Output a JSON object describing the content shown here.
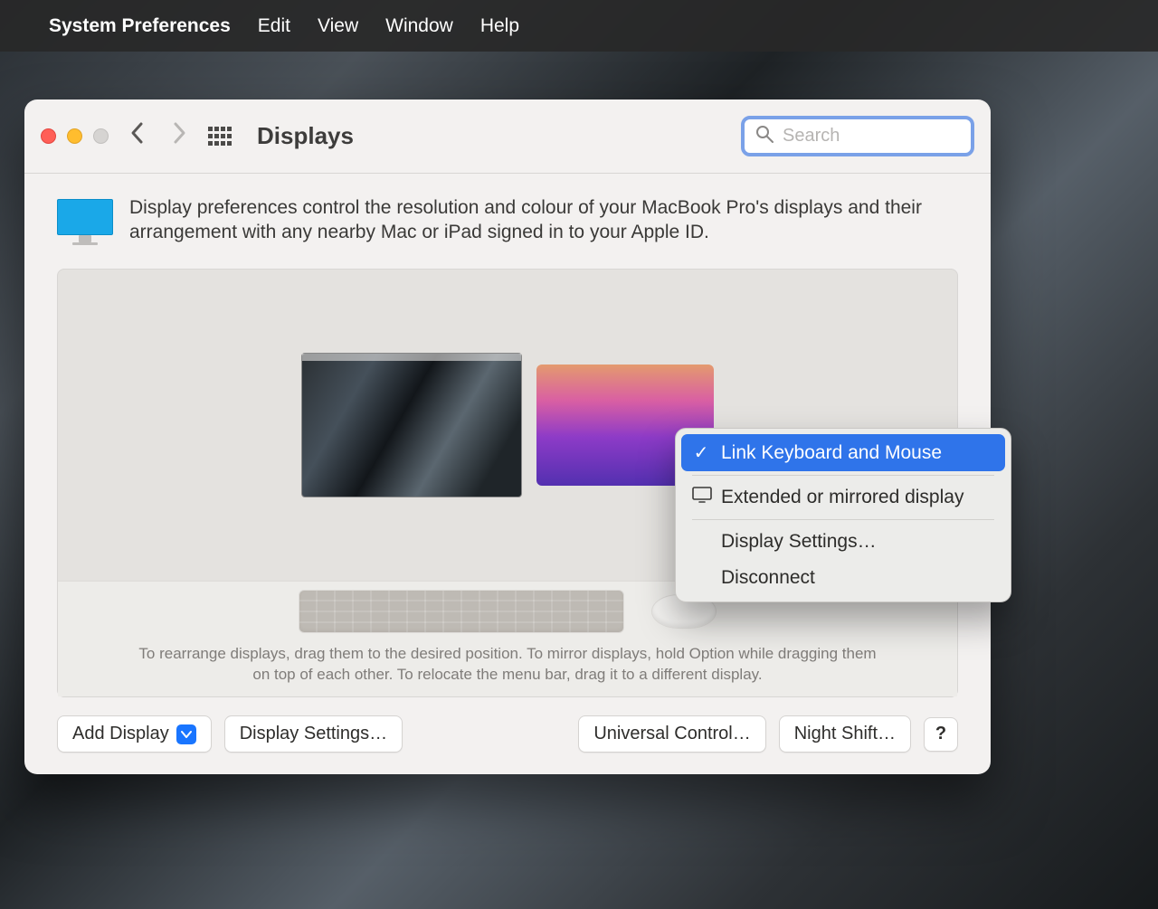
{
  "menubar": {
    "app_name": "System Preferences",
    "items": [
      "Edit",
      "View",
      "Window",
      "Help"
    ]
  },
  "window": {
    "title": "Displays",
    "search_placeholder": "Search"
  },
  "intro_text": "Display preferences control the resolution and colour of your MacBook Pro's displays and their arrangement with any nearby Mac or iPad signed in to your Apple ID.",
  "hint_text": "To rearrange displays, drag them to the desired position. To mirror displays, hold Option while dragging them on top of each other. To relocate the menu bar, drag it to a different display.",
  "footer": {
    "add_display": "Add Display",
    "display_settings": "Display Settings…",
    "universal_control": "Universal Control…",
    "night_shift": "Night Shift…",
    "help": "?"
  },
  "context_menu": {
    "link_kbm": "Link Keyboard and Mouse",
    "extended": "Extended or mirrored display",
    "display_settings": "Display Settings…",
    "disconnect": "Disconnect"
  }
}
